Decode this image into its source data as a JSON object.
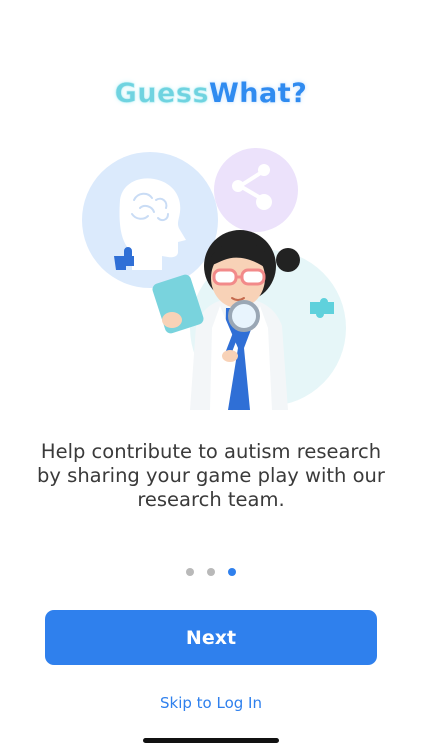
{
  "app": {
    "logo_part1": "Guess",
    "logo_part2": "What?"
  },
  "onboarding": {
    "illustration": "researcher-illustration",
    "message": "Help contribute to autism research by sharing your game play with our research team.",
    "page_count": 3,
    "current_page": 3
  },
  "actions": {
    "next_label": "Next",
    "skip_label": "Skip to Log In"
  },
  "colors": {
    "accent": "#2f80ed",
    "logo_light": "#6fd3e0",
    "logo_dark": "#2f8bf0",
    "dot_inactive": "#b9b9b9"
  }
}
